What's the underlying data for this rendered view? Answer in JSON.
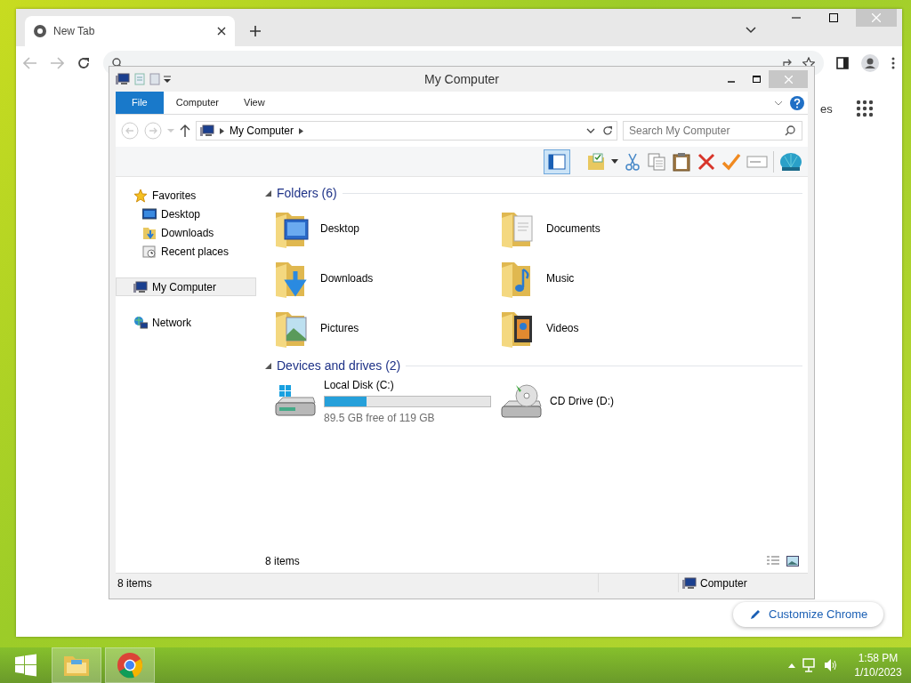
{
  "chrome": {
    "tab_title": "New Tab",
    "shortcut_fragment": "es",
    "customize_button": "Customize Chrome"
  },
  "explorer": {
    "title": "My Computer",
    "ribbon_tabs": [
      {
        "label": "File",
        "selected": true
      },
      {
        "label": "Computer",
        "selected": false
      },
      {
        "label": "View",
        "selected": false
      }
    ],
    "address": "My Computer",
    "search_placeholder": "Search My Computer",
    "nav": [
      {
        "label": "Favorites",
        "kind": "star",
        "selected": false,
        "children": [
          {
            "label": "Desktop",
            "kind": "desktop",
            "selected": false
          },
          {
            "label": "Downloads",
            "kind": "downloads",
            "selected": false
          },
          {
            "label": "Recent places",
            "kind": "recent",
            "selected": false
          }
        ]
      },
      {
        "label": "My Computer",
        "kind": "computer",
        "selected": true
      },
      {
        "label": "Network",
        "kind": "network",
        "selected": false
      }
    ],
    "groups": [
      {
        "title": "Folders (6)",
        "items": [
          {
            "name": "Desktop",
            "kind": "desktop"
          },
          {
            "name": "Documents",
            "kind": "documents"
          },
          {
            "name": "Downloads",
            "kind": "downloads"
          },
          {
            "name": "Music",
            "kind": "music"
          },
          {
            "name": "Pictures",
            "kind": "pictures"
          },
          {
            "name": "Videos",
            "kind": "videos"
          }
        ]
      },
      {
        "title": "Devices and drives (2)",
        "items": [
          {
            "name": "Local Disk (C:)",
            "kind": "disk",
            "level": 0.25,
            "free": "89.5 GB free of 119 GB"
          },
          {
            "name": "CD Drive (D:)",
            "kind": "cd"
          }
        ]
      }
    ],
    "item_count": "8 items",
    "status_bar": {
      "count": "8 items",
      "location": "Computer"
    }
  },
  "taskbar": {
    "time": "1:58 PM",
    "date": "1/10/2023"
  }
}
